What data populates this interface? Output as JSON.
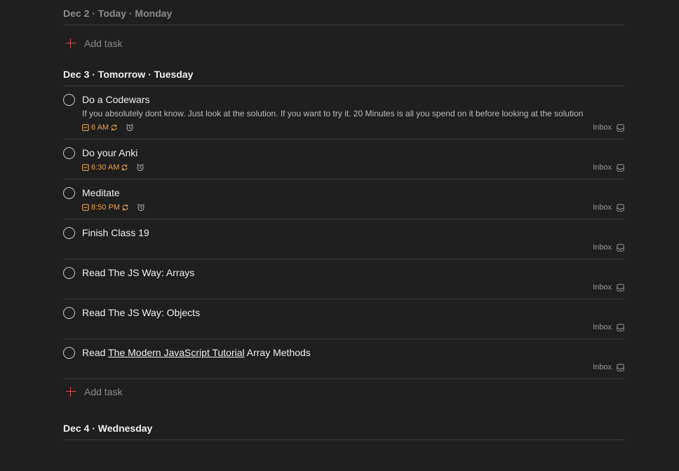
{
  "sections": [
    {
      "header": "Dec 2 · Today · Monday",
      "add_label": "Add task"
    },
    {
      "header": "Dec 3 · Tomorrow · Tuesday",
      "add_label": "Add task",
      "tasks": [
        {
          "title": "Do a Codewars",
          "description": "If you absolutely dont know. Just look at the solution. If you want to try it. 20 Minutes is all you spend on it before looking at the solution",
          "due": "6 AM",
          "project": "Inbox"
        },
        {
          "title": "Do your Anki",
          "due": "6:30 AM",
          "project": "Inbox"
        },
        {
          "title": "Meditate",
          "due": "8:50 PM",
          "project": "Inbox"
        },
        {
          "title": "Finish Class 19",
          "project": "Inbox"
        },
        {
          "title": "Read The JS Way: Arrays",
          "project": "Inbox"
        },
        {
          "title": "Read The JS Way: Objects",
          "project": "Inbox"
        },
        {
          "title_prefix": "Read ",
          "title_link": "The Modern JavaScript Tutorial",
          "title_suffix": " Array Methods",
          "project": "Inbox"
        }
      ]
    },
    {
      "header": "Dec 4 · Wednesday"
    }
  ],
  "colors": {
    "background": "#1f1f1f",
    "due_accent": "#e5a04d",
    "add_plus": "#de4c4a"
  }
}
